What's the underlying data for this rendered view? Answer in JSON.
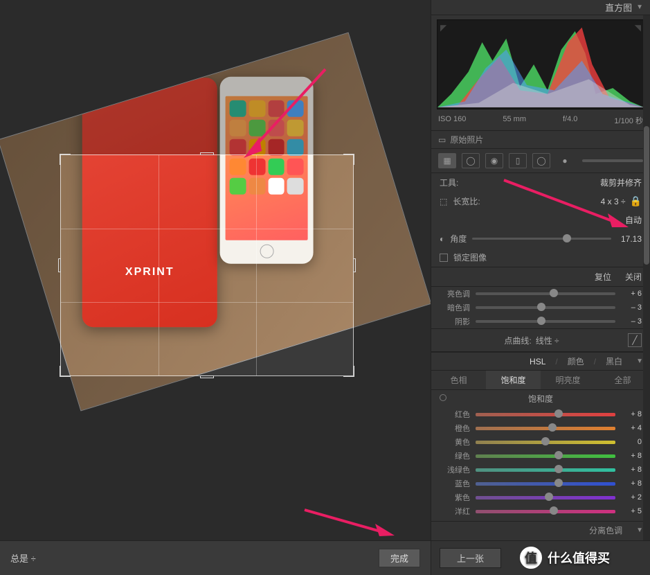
{
  "histogram_panel": {
    "title": "直方图",
    "iso": "ISO 160",
    "focal": "55 mm",
    "aperture": "f/4.0",
    "shutter": "1/100 秒",
    "original_photo": "原始照片"
  },
  "tools": {
    "label": "工具:",
    "name": "裁剪并修齐",
    "aspect": {
      "label": "长宽比:",
      "value": "4 x 3"
    },
    "angle": {
      "label": "角度",
      "auto": "自动",
      "value": "17.13"
    },
    "lock": "锁定图像",
    "reset": "复位",
    "close": "关闭"
  },
  "tone": {
    "highlights": {
      "label": "亮色调",
      "value": "+ 6"
    },
    "darks": {
      "label": "暗色调",
      "value": "– 3"
    },
    "shadows": {
      "label": "阴影",
      "value": "– 3"
    },
    "curve_label": "点曲线:",
    "curve_value": "线性"
  },
  "hsl": {
    "section": {
      "hsl": "HSL",
      "color": "颜色",
      "bw": "黑白"
    },
    "tabs": {
      "hue": "色相",
      "saturation": "饱和度",
      "luminance": "明亮度",
      "all": "全部"
    },
    "active_tab_label": "饱和度",
    "channels": [
      {
        "name": "红色",
        "value": "+ 8",
        "grad": "linear-gradient(90deg,#a06050,#e04040)"
      },
      {
        "name": "橙色",
        "value": "+ 4",
        "grad": "linear-gradient(90deg,#a07050,#e08030)"
      },
      {
        "name": "黄色",
        "value": "0",
        "grad": "linear-gradient(90deg,#908050,#d0c030)"
      },
      {
        "name": "绿色",
        "value": "+ 8",
        "grad": "linear-gradient(90deg,#608050,#40c040)"
      },
      {
        "name": "浅绿色",
        "value": "+ 8",
        "grad": "linear-gradient(90deg,#509080,#30c0a0)"
      },
      {
        "name": "蓝色",
        "value": "+ 8",
        "grad": "linear-gradient(90deg,#506090,#3050d0)"
      },
      {
        "name": "紫色",
        "value": "+ 2",
        "grad": "linear-gradient(90deg,#705090,#8030d0)"
      },
      {
        "name": "洋红",
        "value": "+ 5",
        "grad": "linear-gradient(90deg,#905070,#d03080)"
      }
    ]
  },
  "split_tone": {
    "label": "分离色调"
  },
  "nav": {
    "prev": "上一张"
  },
  "bottom": {
    "always": "总是",
    "done": "完成"
  },
  "device_label": "XPRINT",
  "watermark": "什么值得买",
  "wm_badge": "值"
}
